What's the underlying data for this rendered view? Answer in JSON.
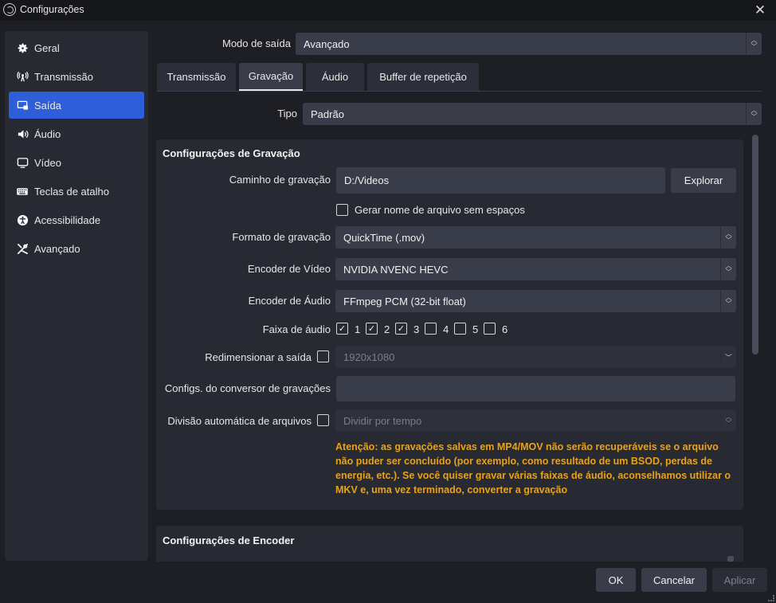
{
  "window": {
    "title": "Configurações",
    "close_glyph": "✕"
  },
  "sidebar": {
    "items": [
      {
        "label": "Geral",
        "icon": "gear-icon",
        "glyph": "⚙",
        "active": false
      },
      {
        "label": "Transmissão",
        "icon": "broadcast-icon",
        "glyph": "📡",
        "active": false
      },
      {
        "label": "Saída",
        "icon": "output-icon",
        "glyph": "▭",
        "active": true
      },
      {
        "label": "Áudio",
        "icon": "speaker-icon",
        "glyph": "🔊",
        "active": false
      },
      {
        "label": "Vídeo",
        "icon": "monitor-icon",
        "glyph": "▭",
        "active": false
      },
      {
        "label": "Teclas de atalho",
        "icon": "keyboard-icon",
        "glyph": "⌨",
        "active": false
      },
      {
        "label": "Acessibilidade",
        "icon": "accessibility-icon",
        "glyph": "♿",
        "active": false
      },
      {
        "label": "Avançado",
        "icon": "tools-icon",
        "glyph": "✂",
        "active": false
      }
    ]
  },
  "output_mode": {
    "label": "Modo de saída",
    "value": "Avançado"
  },
  "tabs": [
    {
      "label": "Transmissão",
      "active": false
    },
    {
      "label": "Gravação",
      "active": true
    },
    {
      "label": "Áudio",
      "active": false
    },
    {
      "label": "Buffer de repetição",
      "active": false
    }
  ],
  "type": {
    "label": "Tipo",
    "value": "Padrão"
  },
  "recording": {
    "title": "Configurações de Gravação",
    "path_label": "Caminho de gravação",
    "path_value": "D:/Videos",
    "browse_label": "Explorar",
    "no_space_label": "Gerar nome de arquivo sem espaços",
    "no_space_checked": false,
    "format_label": "Formato de gravação",
    "format_value": "QuickTime (.mov)",
    "video_encoder_label": "Encoder de Vídeo",
    "video_encoder_value": "NVIDIA NVENC HEVC",
    "audio_encoder_label": "Encoder de Áudio",
    "audio_encoder_value": "FFmpeg PCM (32-bit float)",
    "tracks_label": "Faixa de áudio",
    "tracks": [
      {
        "label": "1",
        "checked": true
      },
      {
        "label": "2",
        "checked": true
      },
      {
        "label": "3",
        "checked": true
      },
      {
        "label": "4",
        "checked": false
      },
      {
        "label": "5",
        "checked": false
      },
      {
        "label": "6",
        "checked": false
      }
    ],
    "rescale_label": "Redimensionar a saída",
    "rescale_checked": false,
    "rescale_value": "1920x1080",
    "muxer_label": "Configs. do conversor de gravações",
    "muxer_value": "",
    "split_label": "Divisão automática de arquivos",
    "split_checked": false,
    "split_value": "Dividir por tempo",
    "warning": "Atenção: as gravações salvas em MP4/MOV não serão recuperáveis se o arquivo não puder ser concluído (por exemplo, como resultado de um BSOD, perdas de energia, etc.). Se você quiser gravar várias faixas de áudio, aconselhamos utilizar o MKV e, uma vez terminado, converter a gravação"
  },
  "encoder": {
    "title": "Configurações de Encoder"
  },
  "footer": {
    "ok": "OK",
    "cancel": "Cancelar",
    "apply": "Aplicar"
  },
  "colors": {
    "accent": "#2f5fd8",
    "warning": "#e8a21a",
    "background": "#1e1f24",
    "panel": "#272a33",
    "control": "#393d49"
  }
}
